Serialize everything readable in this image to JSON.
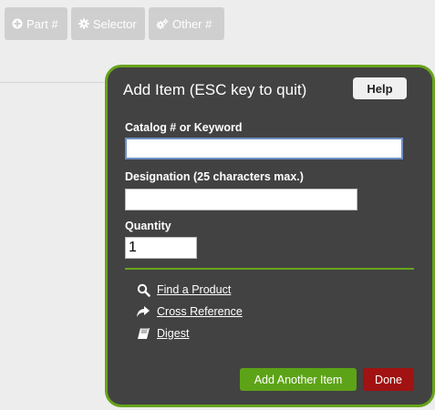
{
  "toolbar": {
    "part_label": "Part #",
    "selector_label": "Selector",
    "other_label": "Other #",
    "part_icon": "plus-circle-icon",
    "selector_icon": "gear-icon",
    "other_icon": "gears-icon"
  },
  "dialog": {
    "title": "Add Item (ESC key to quit)",
    "help_label": "Help",
    "catalog": {
      "label": "Catalog # or Keyword",
      "value": ""
    },
    "designation": {
      "label": "Designation (25 characters max.)",
      "value": ""
    },
    "quantity": {
      "label": "Quantity",
      "value": "1"
    },
    "links": [
      {
        "label": "Find a Product",
        "icon": "search-icon"
      },
      {
        "label": "Cross Reference",
        "icon": "share-arrow-icon"
      },
      {
        "label": "Digest",
        "icon": "book-icon"
      }
    ],
    "add_another_label": "Add Another Item",
    "done_label": "Done"
  },
  "colors": {
    "page_bg": "#ededed",
    "toolbar_button_bg": "#cfcfcf",
    "dialog_bg": "#424242",
    "dialog_border": "#67a41a",
    "add_button": "#5da317",
    "done_button": "#a11212"
  }
}
